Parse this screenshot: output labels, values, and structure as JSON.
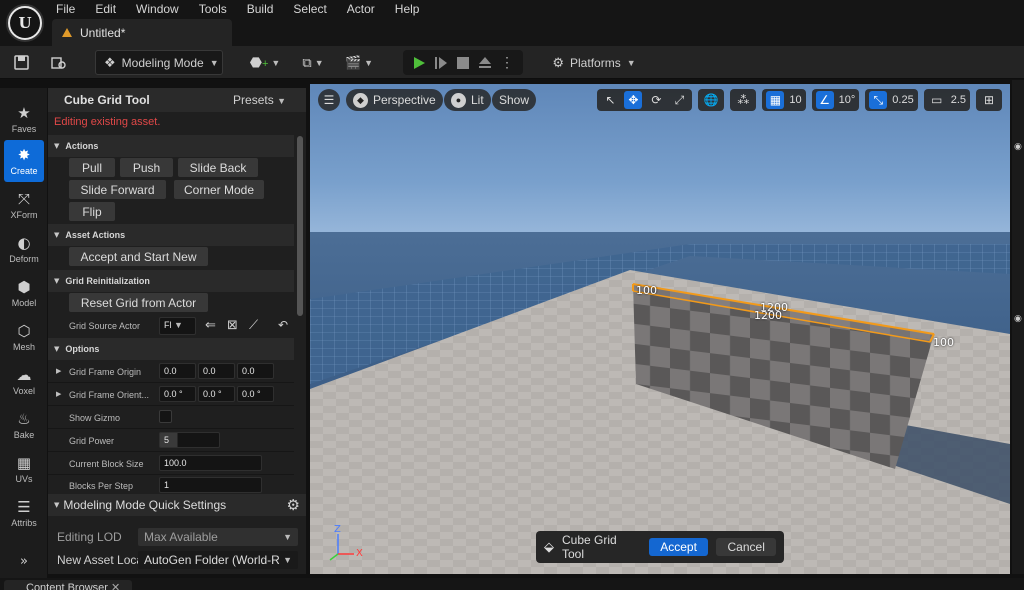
{
  "menu": {
    "logo": "U",
    "items": [
      "File",
      "Edit",
      "Window",
      "Tools",
      "Build",
      "Select",
      "Actor",
      "Help"
    ]
  },
  "document_tab": {
    "label": "Untitled*"
  },
  "toolbar": {
    "mode_label": "Modeling Mode",
    "platforms_label": "Platforms"
  },
  "mode_strip": {
    "items": [
      {
        "label": "Faves",
        "icon": "star-icon"
      },
      {
        "label": "Create",
        "icon": "create-icon"
      },
      {
        "label": "XForm",
        "icon": "transform-icon"
      },
      {
        "label": "Deform",
        "icon": "deform-icon"
      },
      {
        "label": "Model",
        "icon": "model-icon"
      },
      {
        "label": "Mesh",
        "icon": "mesh-icon"
      },
      {
        "label": "Voxel",
        "icon": "voxel-icon"
      },
      {
        "label": "Bake",
        "icon": "bake-icon"
      },
      {
        "label": "UVs",
        "icon": "uvs-icon"
      },
      {
        "label": "Attribs",
        "icon": "attribs-icon"
      }
    ],
    "active": "Create",
    "expand": "»"
  },
  "tool_panel": {
    "title": "Cube Grid Tool",
    "presets": "Presets",
    "warning": "Editing existing asset.",
    "sections": {
      "actions": "Actions",
      "asset_actions": "Asset Actions",
      "grid_reinit": "Grid Reinitialization",
      "options": "Options"
    },
    "action_buttons": [
      "Pull",
      "Push",
      "Slide Back",
      "Slide Forward",
      "Corner Mode",
      "Flip"
    ],
    "accept_and_start_new": "Accept and Start New",
    "reset_grid": "Reset Grid from Actor",
    "grid_source_actor": {
      "label": "Grid Source Actor",
      "value": "Fl"
    },
    "options": {
      "grid_frame_origin": {
        "label": "Grid Frame Origin",
        "values": [
          "0.0",
          "0.0",
          "0.0"
        ]
      },
      "grid_frame_orient": {
        "label": "Grid Frame Orient...",
        "values": [
          "0.0 °",
          "0.0 °",
          "0.0 °"
        ]
      },
      "show_gizmo": {
        "label": "Show Gizmo",
        "checked": false
      },
      "grid_power": {
        "label": "Grid Power",
        "value": "5"
      },
      "current_block_size": {
        "label": "Current Block Size",
        "value": "100.0"
      },
      "blocks_per_step": {
        "label": "Blocks Per Step",
        "value": "1"
      }
    }
  },
  "quick_settings": {
    "title": "Modeling Mode Quick Settings",
    "editing_lod": {
      "label": "Editing LOD",
      "value": "Max Available"
    },
    "new_asset_location": {
      "label": "New Asset Loca",
      "value": "AutoGen Folder (World-R"
    }
  },
  "viewport": {
    "perspective": "Perspective",
    "lit": "Lit",
    "show": "Show",
    "grid_snap": "10",
    "rotation_snap": "10°",
    "scale_snap": "0.25",
    "camera_speed": "2.5",
    "dimension_labels": [
      "100",
      "1200",
      "1200",
      "100"
    ],
    "axes": {
      "z": "Z",
      "x": "X"
    }
  },
  "accept_bar": {
    "tool_name": "Cube Grid Tool",
    "accept": "Accept",
    "cancel": "Cancel"
  },
  "bottom": {
    "content_browser": "Content Browser"
  },
  "colors": {
    "accent_blue": "#0e6bd8",
    "warning_red": "#e04848",
    "play_green": "#4fbf3a",
    "selection_orange": "#f29a1a"
  }
}
